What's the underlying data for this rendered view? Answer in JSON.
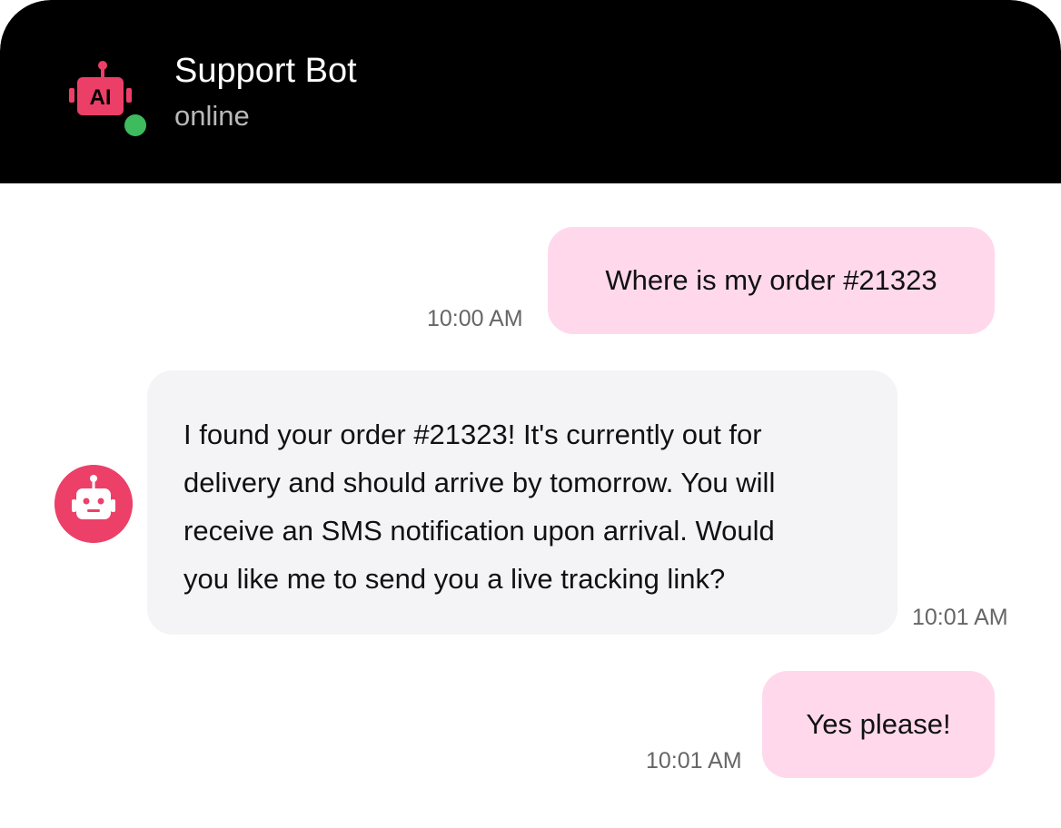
{
  "header": {
    "bot_name": "Support Bot",
    "bot_status": "online",
    "avatar_text": "AI",
    "status_color": "#3dbb5d",
    "accent_color": "#ec3f68"
  },
  "messages": [
    {
      "from": "user",
      "text": "Where is my order #21323",
      "time": "10:00 AM"
    },
    {
      "from": "bot",
      "lines": [
        "I found your order #21323! It's currently out for",
        "delivery and should arrive by tomorrow. You will",
        "receive an SMS notification upon arrival. Would",
        "you like me to send you a live tracking link?"
      ],
      "time": "10:01 AM"
    },
    {
      "from": "user",
      "text": "Yes please!",
      "time": "10:01 AM"
    }
  ],
  "colors": {
    "header_bg": "#000000",
    "user_bubble": "#ffd9eb",
    "bot_bubble": "#f4f4f6"
  }
}
